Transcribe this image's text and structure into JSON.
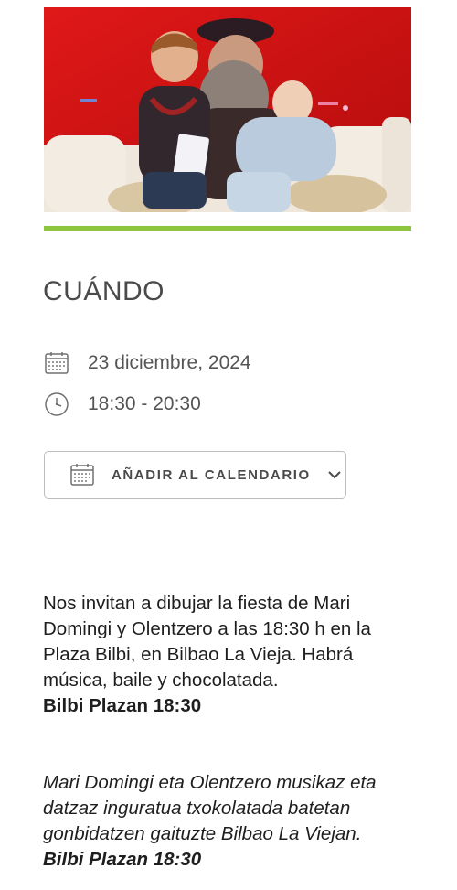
{
  "hero": {
    "icon": "photo-olentzero-with-children"
  },
  "colors": {
    "accent": "#8cc63f",
    "hero_background": "#d81414",
    "text_muted": "#555555",
    "button_border": "#bdbdbd"
  },
  "when": {
    "title": "CUÁNDO",
    "date": "23 diciembre, 2024",
    "date_icon": "calendar-icon",
    "time": "18:30 - 20:30",
    "time_icon": "clock-icon"
  },
  "calendar_button": {
    "label": "AÑADIR AL CALENDARIO",
    "icon": "calendar-icon",
    "dropdown_icon": "chevron-down-icon"
  },
  "description_es": {
    "text": "Nos invitan a dibujar la fiesta de Mari Domingi y Olentzero a las 18:30 h en la Plaza Bilbi, en Bilbao La Vieja. Habrá música, baile y chocolatada.",
    "place": "Bilbi Plazan 18:30"
  },
  "description_eu": {
    "text": "Mari Domingi eta Olentzero musikaz eta datzaz inguratua txokolatada batetan gonbidatzen gaituzte Bilbao La Viejan.",
    "place": "Bilbi Plazan 18:30"
  }
}
